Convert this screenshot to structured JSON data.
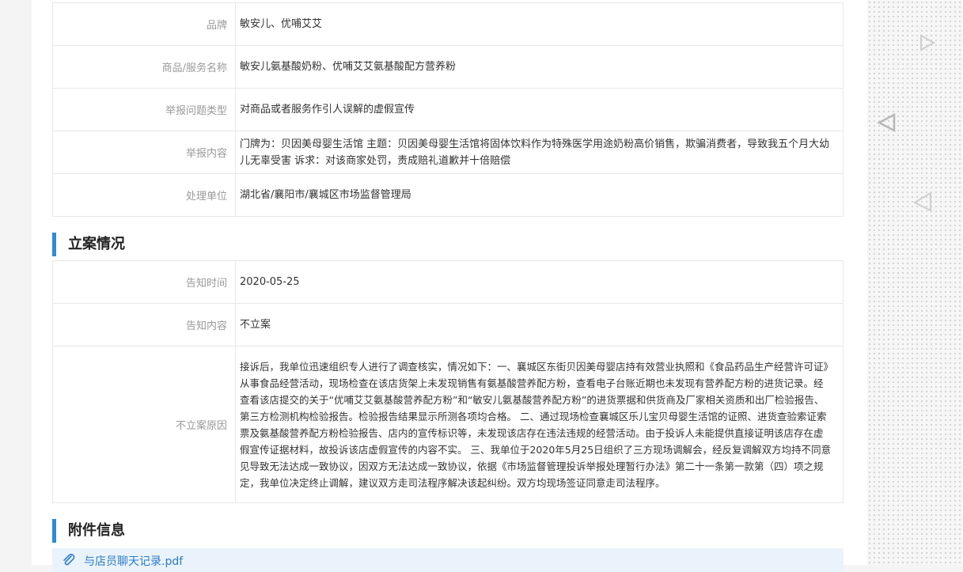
{
  "complaint_info": {
    "rows": [
      {
        "label": "品牌",
        "value": "敏安儿、优哺艾艾"
      },
      {
        "label": "商品/服务名称",
        "value": "敏安儿氨基酸奶粉、优哺艾艾氨基酸配方营养粉"
      },
      {
        "label": "举报问题类型",
        "value": "对商品或者服务作引人误解的虚假宣传"
      },
      {
        "label": "举报内容",
        "value": "门牌为：贝因美母婴生活馆 主题：贝因美母婴生活馆将固体饮料作为特殊医学用途奶粉高价销售，欺骗消费者，导致我五个月大幼儿无辜受害 诉求：对该商家处罚，责成赔礼道歉并十倍赔偿"
      },
      {
        "label": "处理单位",
        "value": "湖北省/襄阳市/襄城区市场监督管理局"
      }
    ]
  },
  "filing": {
    "title": "立案情况",
    "rows": [
      {
        "label": "告知时间",
        "value": "2020-05-25"
      },
      {
        "label": "告知内容",
        "value": "不立案"
      },
      {
        "label": "不立案原因",
        "value": "接诉后，我单位迅速组织专人进行了调查核实，情况如下：一、襄城区东街贝因美母婴店持有效营业执照和《食品药品生产经营许可证》从事食品经营活动，现场检查在该店货架上未发现销售有氨基酸营养配方粉，查看电子台账近期也未发现有营养配方粉的进货记录。经查看该店提交的关于“优哺艾艾氨基酸营养配方粉”和“敏安儿氨基酸营养配方粉”的进货票据和供货商及厂家相关资质和出厂检验报告、第三方检测机构检验报告。检验报告结果显示所测各项均合格。 二、通过现场检查襄城区乐儿宝贝母婴生活馆的证照、进货查验索证索票及氨基酸营养配方粉检验报告、店内的宣传标识等，未发现该店存在违法违规的经营活动。由于投诉人未能提供直接证明该店存在虚假宣传证据材料，故投诉该店虚假宣传的内容不实。 三、我单位于2020年5月25日组织了三方现场调解会，经反复调解双方均持不同意见导致无法达成一致协议，因双方无法达成一致协议，依据《市场监督管理投诉举报处理暂行办法》第二十一条第一款第（四）项之规定，我单位决定终止调解，建议双方走司法程序解决该起纠纷。双方均现场签证同意走司法程序。"
      }
    ]
  },
  "attachments": {
    "title": "附件信息",
    "files": [
      {
        "name": "与店员聊天记录.pdf",
        "icon": "paperclip-icon"
      }
    ]
  },
  "colors": {
    "accent": "#2f8ad7",
    "link": "#2a7bc4",
    "label": "#999999",
    "border": "#e8e8e8"
  }
}
